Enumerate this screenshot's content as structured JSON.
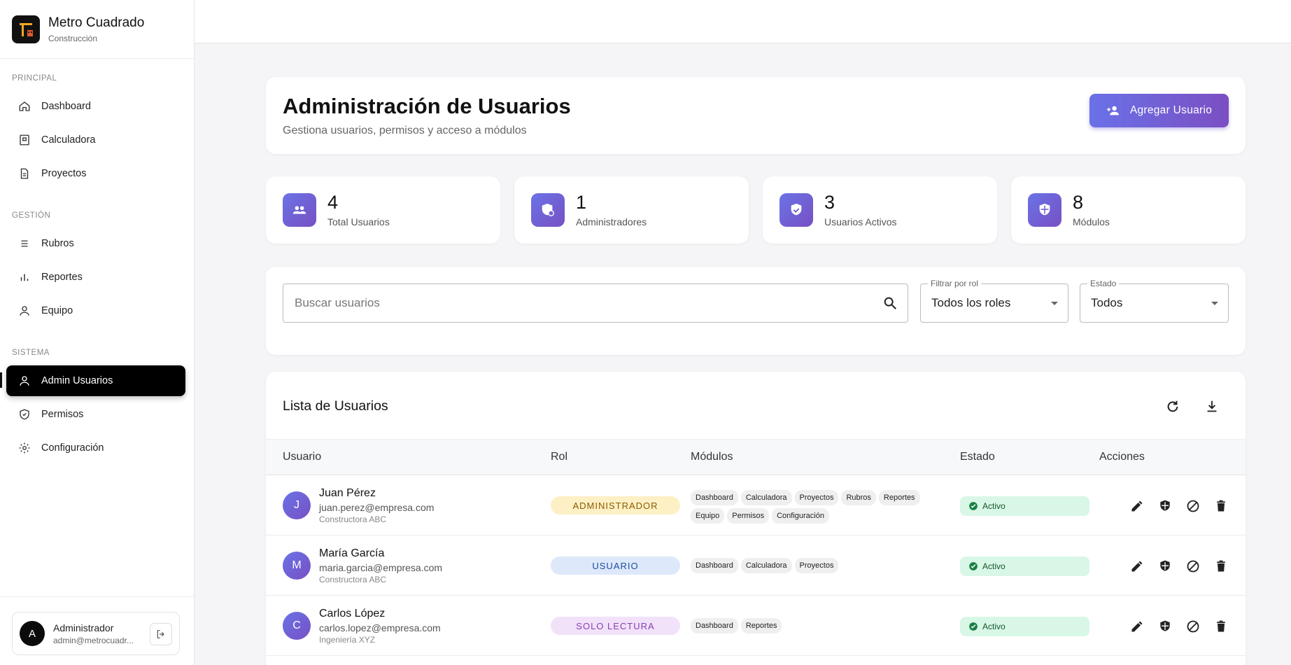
{
  "brand": {
    "title": "Metro Cuadrado",
    "subtitle": "Construcción"
  },
  "nav": {
    "sections": [
      "PRINCIPAL",
      "GESTIÓN",
      "SISTEMA"
    ],
    "items": [
      {
        "label": "Dashboard",
        "icon": "home-icon"
      },
      {
        "label": "Calculadora",
        "icon": "calculator-icon"
      },
      {
        "label": "Proyectos",
        "icon": "document-icon"
      },
      {
        "label": "Rubros",
        "icon": "list-icon"
      },
      {
        "label": "Reportes",
        "icon": "bar-chart-icon"
      },
      {
        "label": "Equipo",
        "icon": "person-icon"
      },
      {
        "label": "Admin Usuarios",
        "icon": "admin-user-icon",
        "active": true
      },
      {
        "label": "Permisos",
        "icon": "shield-icon"
      },
      {
        "label": "Configuración",
        "icon": "gear-icon"
      }
    ]
  },
  "current_user": {
    "initial": "A",
    "name": "Administrador",
    "email": "admin@metrocuadr..."
  },
  "header": {
    "title": "Administración de Usuarios",
    "subtitle": "Gestiona usuarios, permisos y acceso a módulos",
    "add_button": "Agregar Usuario"
  },
  "stats": [
    {
      "value": "4",
      "label": "Total Usuarios",
      "icon": "group-icon"
    },
    {
      "value": "1",
      "label": "Administradores",
      "icon": "admin-shield-icon"
    },
    {
      "value": "3",
      "label": "Usuarios Activos",
      "icon": "verified-shield-icon"
    },
    {
      "value": "8",
      "label": "Módulos",
      "icon": "security-shield-icon"
    }
  ],
  "filters": {
    "search_placeholder": "Buscar usuarios",
    "role_label": "Filtrar por rol",
    "role_value": "Todos los roles",
    "status_label": "Estado",
    "status_value": "Todos"
  },
  "table": {
    "title": "Lista de Usuarios",
    "columns": [
      "Usuario",
      "Rol",
      "Módulos",
      "Estado",
      "Acciones"
    ],
    "rows": [
      {
        "initial": "J",
        "name": "Juan Pérez",
        "email": "juan.perez@empresa.com",
        "company": "Constructora ABC",
        "role": "ADMINISTRADOR",
        "modules": [
          "Dashboard",
          "Calculadora",
          "Proyectos",
          "Rubros",
          "Reportes",
          "Equipo",
          "Permisos",
          "Configuración"
        ],
        "status": "Activo"
      },
      {
        "initial": "M",
        "name": "María García",
        "email": "maria.garcia@empresa.com",
        "company": "Constructora ABC",
        "role": "USUARIO",
        "modules": [
          "Dashboard",
          "Calculadora",
          "Proyectos"
        ],
        "status": "Activo"
      },
      {
        "initial": "C",
        "name": "Carlos López",
        "email": "carlos.lopez@empresa.com",
        "company": "Ingeniería XYZ",
        "role": "SOLO LECTURA",
        "modules": [
          "Dashboard",
          "Reportes"
        ],
        "status": "Activo"
      }
    ]
  },
  "colors": {
    "accent_start": "#6a71e8",
    "accent_end": "#7b4fc2",
    "active_nav": "#000000",
    "status_active": "#d9f7e6"
  }
}
